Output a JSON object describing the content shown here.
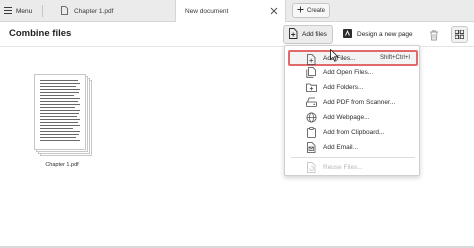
{
  "tabs": {
    "menu_label": "Menu",
    "items": [
      {
        "label": "Chapter 1.pdf"
      },
      {
        "label": "New document"
      }
    ],
    "create_label": "Create"
  },
  "toolbar": {
    "title": "Combine files",
    "add_files_label": "Add files",
    "design_label": "Design a new page"
  },
  "file": {
    "name": "Chapter 1.pdf"
  },
  "dropdown": {
    "items": [
      {
        "label": "Add Files...",
        "shortcut": "Shift+Ctrl+I",
        "icon": "add-file-icon",
        "highlighted": true
      },
      {
        "label": "Add Open Files...",
        "icon": "open-files-icon"
      },
      {
        "label": "Add Folders...",
        "icon": "folder-icon"
      },
      {
        "label": "Add PDF from Scanner...",
        "icon": "scanner-icon"
      },
      {
        "label": "Add Webpage...",
        "icon": "globe-icon"
      },
      {
        "label": "Add from Clipboard...",
        "icon": "clipboard-icon"
      },
      {
        "label": "Add Email...",
        "icon": "email-icon"
      },
      {
        "label": "Reuse Files...",
        "icon": "reuse-files-icon",
        "disabled": true
      }
    ]
  },
  "colors": {
    "highlight_border": "#e06a6a",
    "tabstrip_bg": "#ebebeb"
  }
}
